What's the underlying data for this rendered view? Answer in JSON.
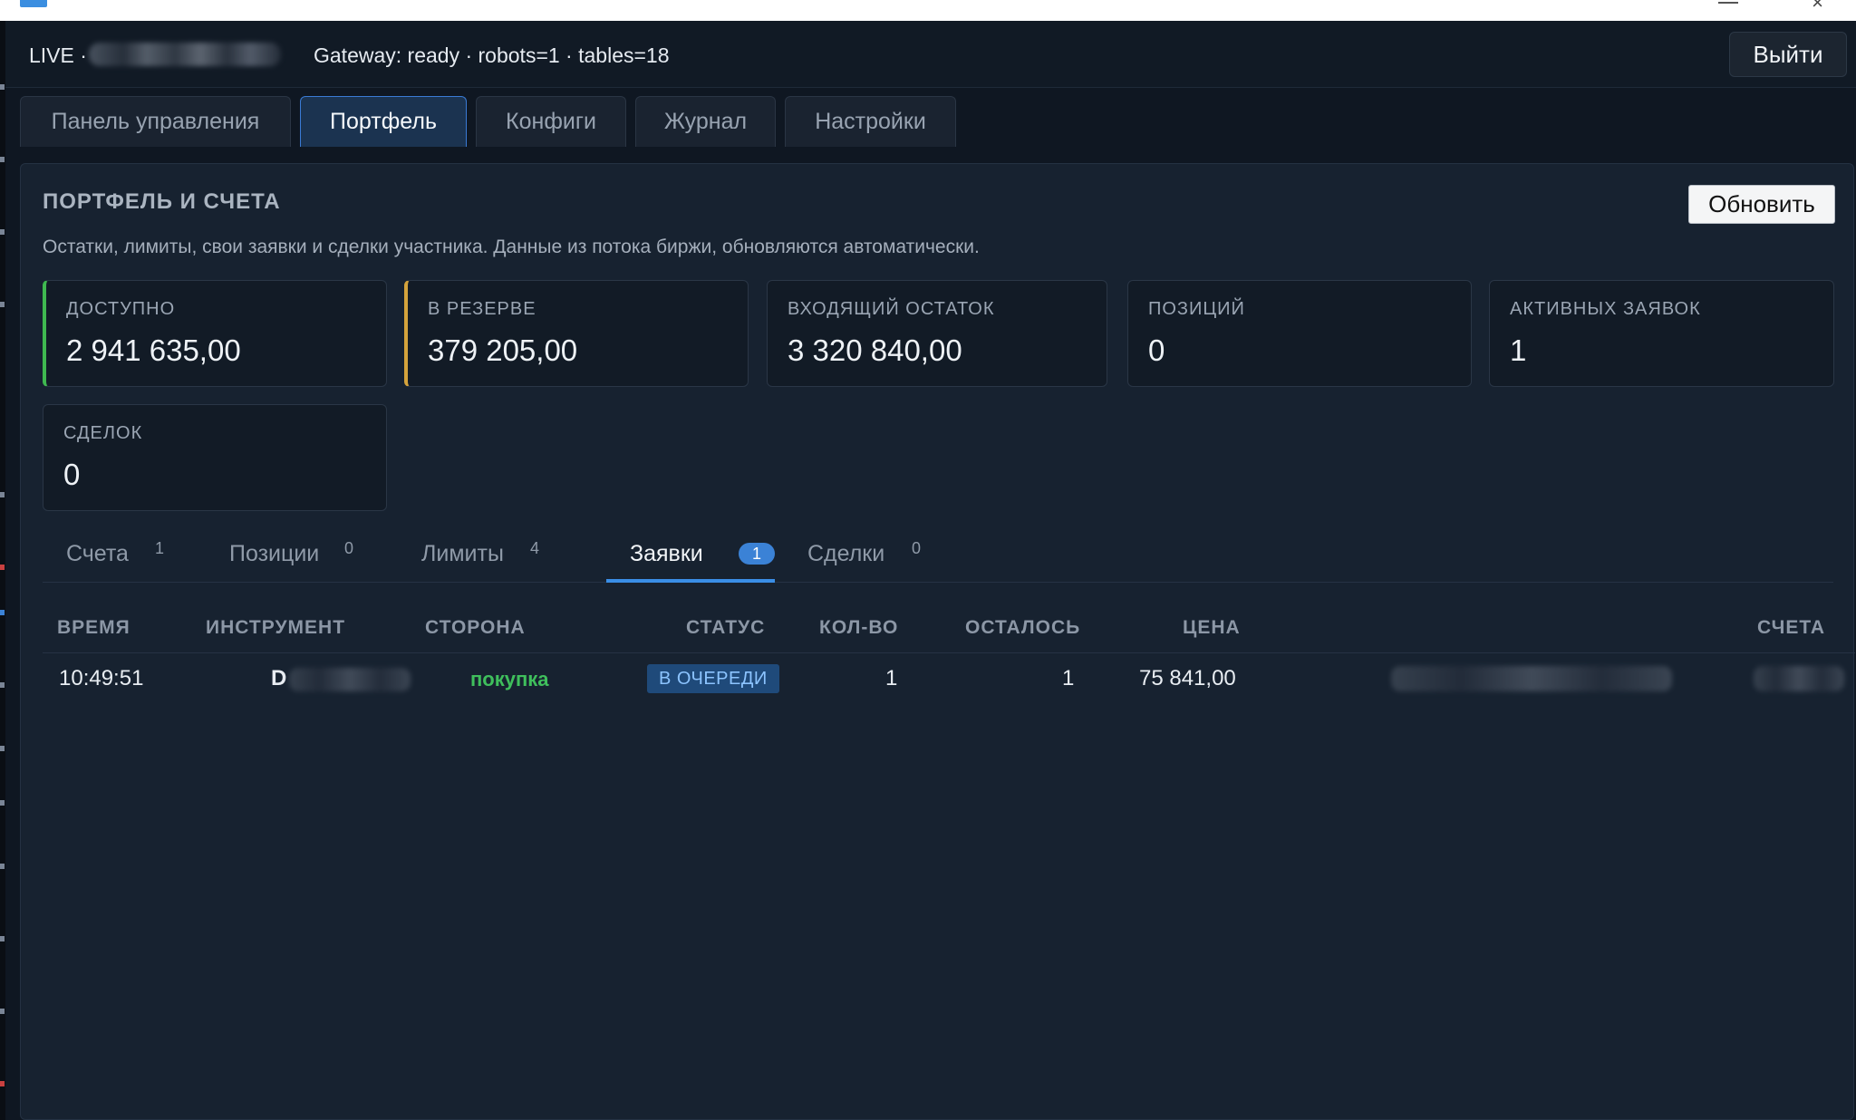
{
  "window": {
    "title": ""
  },
  "header": {
    "live_label": "LIVE ·",
    "gateway_status": "Gateway: ready · robots=1 · tables=18",
    "logout_label": "Выйти"
  },
  "tabs": [
    {
      "label": "Панель управления",
      "active": false
    },
    {
      "label": "Портфель",
      "active": true
    },
    {
      "label": "Конфиги",
      "active": false
    },
    {
      "label": "Журнал",
      "active": false
    },
    {
      "label": "Настройки",
      "active": false
    }
  ],
  "panel": {
    "title": "ПОРТФЕЛЬ И СЧЕТА",
    "refresh_label": "Обновить",
    "description": "Остатки, лимиты, свои заявки и сделки участника. Данные из потока биржи, обновляются автоматически."
  },
  "cards": [
    {
      "label": "ДОСТУПНО",
      "value": "2 941 635,00",
      "accent": "#3fb950"
    },
    {
      "label": "В РЕЗЕРВЕ",
      "value": "379 205,00",
      "accent": "#d4a33c"
    },
    {
      "label": "ВХОДЯЩИЙ ОСТАТОК",
      "value": "3 320 840,00"
    },
    {
      "label": "ПОЗИЦИЙ",
      "value": "0"
    },
    {
      "label": "АКТИВНЫХ ЗАЯВОК",
      "value": "1"
    },
    {
      "label": "СДЕЛОК",
      "value": "0"
    }
  ],
  "subtabs": [
    {
      "label": "Счета",
      "count": "1",
      "active": false
    },
    {
      "label": "Позиции",
      "count": "0",
      "active": false
    },
    {
      "label": "Лимиты",
      "count": "4",
      "active": false
    },
    {
      "label": "Заявки",
      "count": "1",
      "active": true
    },
    {
      "label": "Сделки",
      "count": "0",
      "active": false
    }
  ],
  "orders_table": {
    "columns": [
      "ВРЕМЯ",
      "ИНСТРУМЕНТ",
      "СТОРОНА",
      "СТАТУС",
      "КОЛ-ВО",
      "ОСТАЛОСЬ",
      "ЦЕНА",
      "СЧЕТА"
    ],
    "rows": [
      {
        "time": "10:49:51",
        "instrument_prefix": "D",
        "side": "покупка",
        "status": "В ОЧЕРЕДИ",
        "qty": "1",
        "remaining": "1",
        "price": "75 841,00"
      }
    ]
  },
  "colors": {
    "accent_blue": "#3a8ee6",
    "buy_green": "#3fbf5c",
    "status_bg": "#1f4a7a"
  }
}
